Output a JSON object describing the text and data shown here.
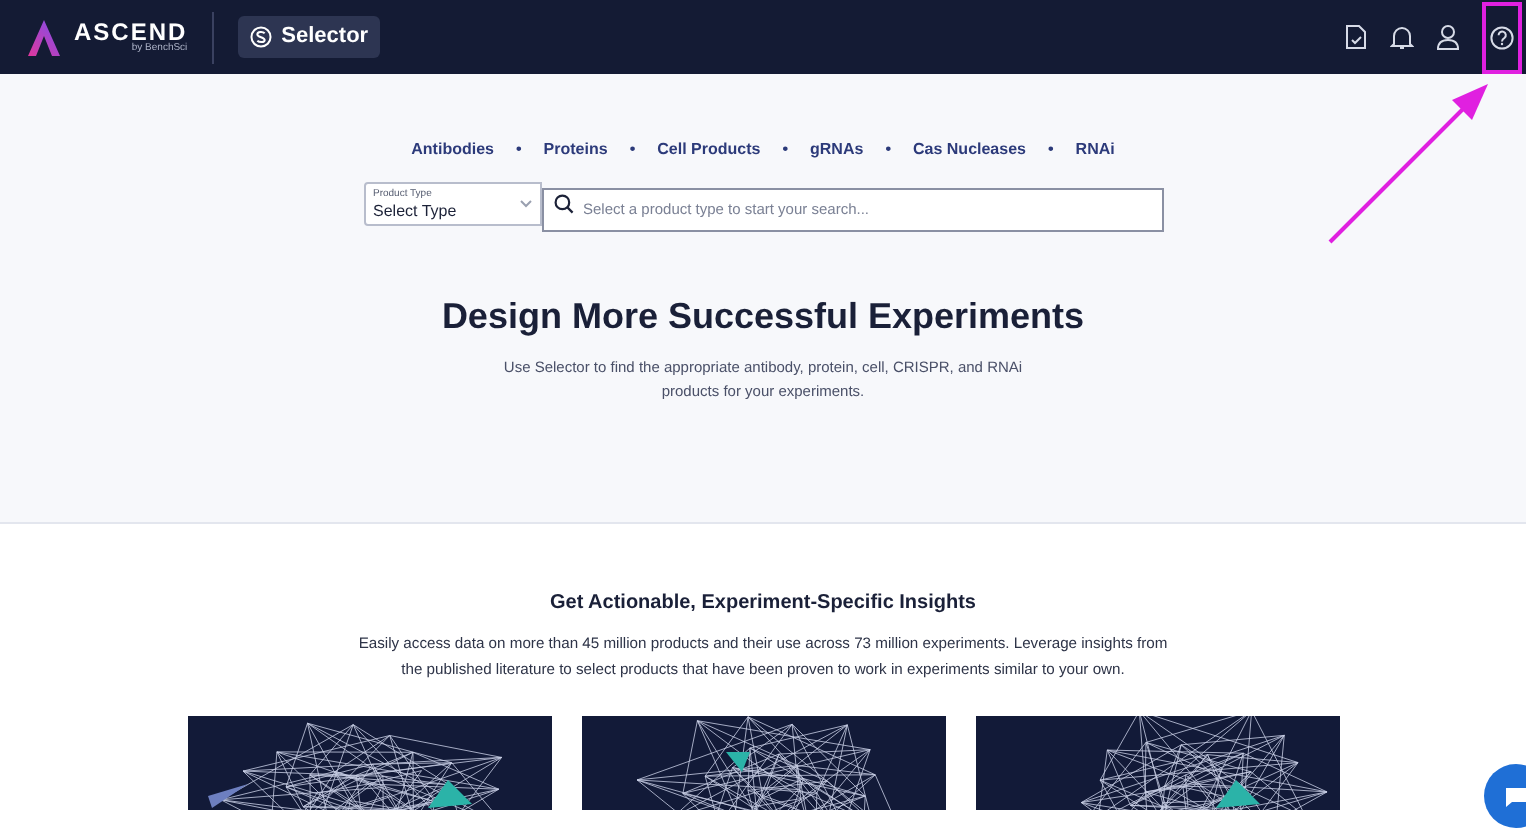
{
  "header": {
    "logo": {
      "name": "ASCEND",
      "tagline": "by BenchSci"
    },
    "app_button": "Selector"
  },
  "categories": [
    "Antibodies",
    "Proteins",
    "Cell Products",
    "gRNAs",
    "Cas Nucleases",
    "RNAi"
  ],
  "category_separator": "•",
  "search": {
    "type_label": "Product Type",
    "type_value": "Select Type",
    "placeholder": "Select a product type to start your search..."
  },
  "hero": {
    "title": "Design More Successful Experiments",
    "subtitle": "Use Selector to find the appropriate antibody, protein, cell, CRISPR, and RNAi products for your experiments."
  },
  "insights": {
    "title": "Get Actionable, Experiment-Specific Insights",
    "body": "Easily access data on more than 45 million products and their use across 73 million experiments. Leverage insights from the published literature to select products that have been proven to work in experiments similar to your own."
  },
  "toolbar_icons": [
    {
      "kind": "doc",
      "highlighted": false
    },
    {
      "kind": "bell",
      "highlighted": false
    },
    {
      "kind": "user",
      "highlighted": false
    },
    {
      "kind": "help",
      "highlighted": true
    }
  ]
}
